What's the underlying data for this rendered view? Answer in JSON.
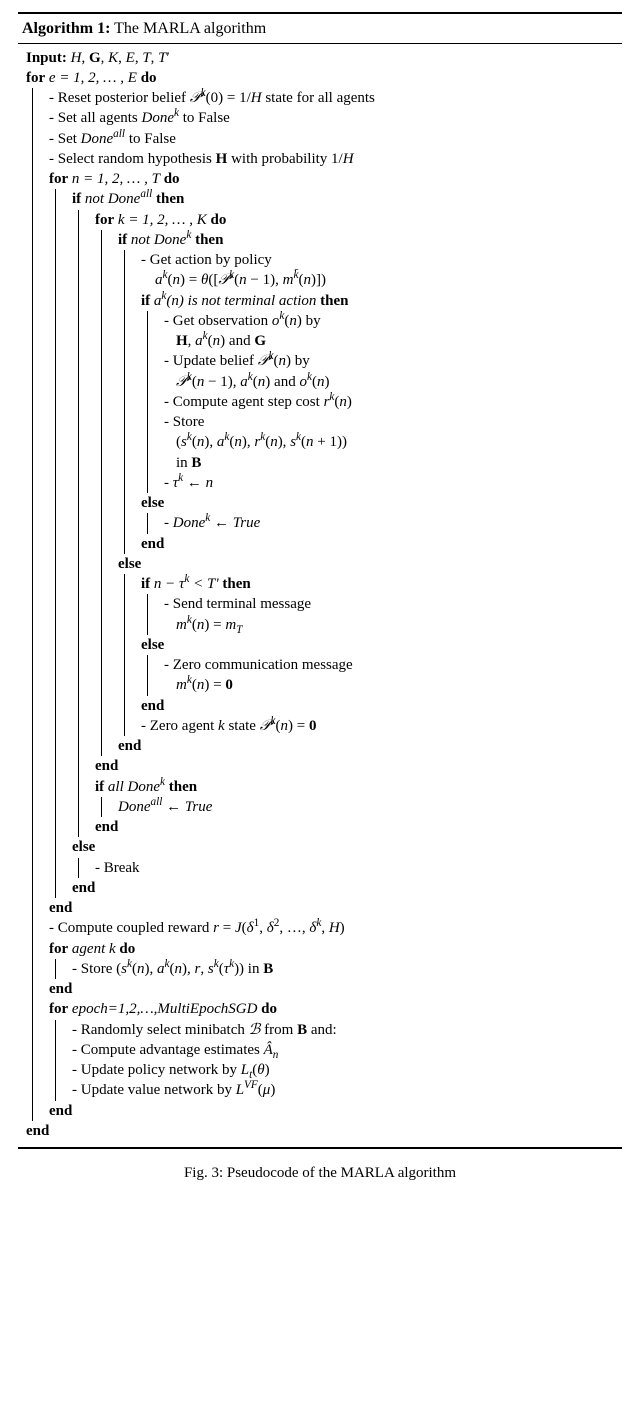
{
  "title_prefix": "Algorithm 1:",
  "title_text": "The MARLA algorithm",
  "input_label": "Input:",
  "input_vars": "H, 𝐆, K, E, T, Tʹ",
  "caption": "Fig. 3: Pseudocode of the MARLA algorithm",
  "lines": {
    "for_e": "e = 1, 2, … , E",
    "reset_belief": "- Reset posterior belief 𝒫ᵏ(0) = 1/H state for all agents",
    "set_donek": "- Set all agents Doneᵏ to False",
    "set_doneall": "- Set Doneᵃˡˡ to False",
    "select_H": "- Select random hypothesis 𝐇 with probability 1/H",
    "for_n": "n = 1, 2, … , T",
    "if_not_doneall": "not Doneᵃˡˡ",
    "for_k": "k = 1, 2, … , K",
    "if_not_donek": "not Doneᵏ",
    "get_action": "- Get action by policy",
    "get_action_eq": "aᵏ(n) = θ([𝒫ᵏ(n − 1), mᵏ̄(n)])",
    "if_a_not_terminal": "aᵏ(n) is not terminal action",
    "get_obs": "- Get observation oᵏ(n) by",
    "get_obs2": "𝐇, aᵏ(n) and 𝐆",
    "update_belief": "- Update belief 𝒫ᵏ(n) by",
    "update_belief2": "𝒫ᵏ(n − 1), aᵏ(n) and oᵏ(n)",
    "compute_cost": "- Compute agent step cost rᵏ(n)",
    "store1": "- Store",
    "store1b": "(sᵏ(n), aᵏ(n), rᵏ(n), sᵏ(n + 1))",
    "store1c": "in 𝐁",
    "tau_assign": "- τᵏ ← n",
    "donek_true": "- Doneᵏ ← True",
    "if_n_tau": "n − τᵏ < Tʹ",
    "send_term": "- Send terminal message",
    "send_term2": "mᵏ(n) = m_T",
    "zero_comm": "- Zero communication message",
    "zero_comm2": "mᵏ(n) = 𝟎",
    "zero_state": "- Zero agent k state 𝒫ᵏ(n) = 𝟎",
    "if_all_done": "all Doneᵏ",
    "doneall_true": "Doneᵃˡˡ ← True",
    "break": "- Break",
    "compute_reward": "- Compute coupled reward r = J(δ¹, δ², …, δᵏ, H)",
    "for_agent_k": "agent k",
    "store2": "- Store (sᵏ(n), aᵏ(n), r, sᵏ(τᵏ)) in 𝐁",
    "for_epoch": "epoch=1,2,…,MultiEpochSGD",
    "rand_mb": "- Randomly select minibatch ℬ from 𝐁 and:",
    "compute_adv": "- Compute advantage estimates Âₙ",
    "update_policy": "- Update policy network by Lₜ(θ)",
    "update_value": "- Update value network by Lⱽᶠ(μ)"
  },
  "kw": {
    "for": "for",
    "do": "do",
    "if": "if",
    "then": "then",
    "else": "else",
    "end": "end"
  }
}
